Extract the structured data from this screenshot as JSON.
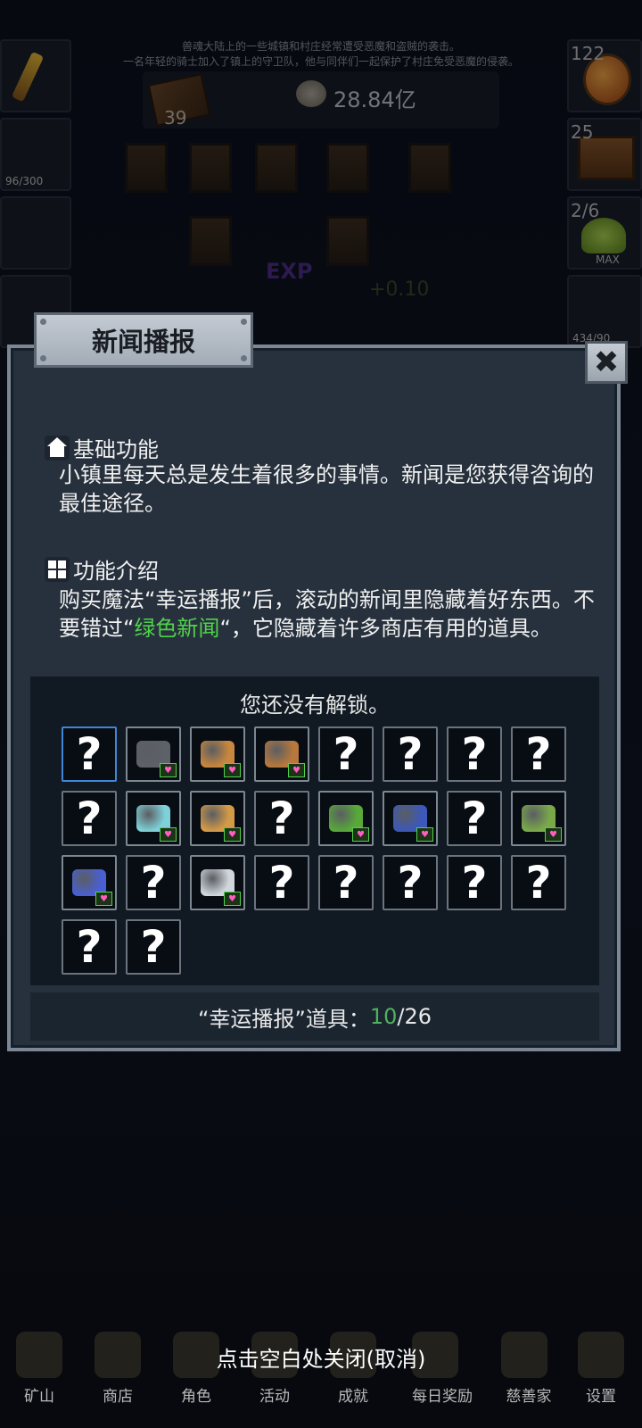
{
  "background": {
    "ticker_line1": "兽魂大陆上的一些城镇和村庄经常遭受恶魔和盗贼的袭击。",
    "ticker_line2": "一名年轻的骑士加入了镇上的守卫队，他与同伴们一起保护了村庄免受恶魔的侵袭。",
    "book_count": "39",
    "gold": "28.84亿",
    "left_slot_sub": "96/300",
    "right_potion": "122",
    "right_chest": "25",
    "right_slime": "2/6",
    "right_slime_sub": "MAX",
    "right_sword_sub": "434/90",
    "exp_label": "EXP",
    "exp_plus": "+0.10"
  },
  "modal": {
    "title": "新闻播报",
    "close_label": "✖",
    "section1_title": "基础功能",
    "section1_text": "小镇里每天总是发生着很多的事情。新闻是您获得咨询的最佳途径。",
    "section2_title": "功能介绍",
    "section2_text_a": "购买魔法“幸运播报”后，滚动的新闻里隐藏着好东西。不要错过“",
    "section2_highlight": "绿色新闻",
    "section2_text_b": "“，它隐藏着许多商店有用的道具。",
    "unlock_message": "您还没有解锁。",
    "count_label": "“幸运播报”道具：",
    "count_have": "10",
    "count_sep": " / ",
    "count_total": "26"
  },
  "items": [
    {
      "state": "unknown",
      "selected": true
    },
    {
      "state": "unlocked",
      "icon": "ore-stone-icon",
      "color": "#5d6168"
    },
    {
      "state": "unlocked",
      "icon": "copper-nugget-icon",
      "color": "#c8863e"
    },
    {
      "state": "unlocked",
      "icon": "wood-plank-icon",
      "color": "#b7773d"
    },
    {
      "state": "unknown"
    },
    {
      "state": "unknown"
    },
    {
      "state": "unknown"
    },
    {
      "state": "unknown"
    },
    {
      "state": "unknown"
    },
    {
      "state": "unlocked",
      "icon": "crystal-cluster-icon",
      "color": "#7fd0d8"
    },
    {
      "state": "unlocked",
      "icon": "amber-ore-icon",
      "color": "#d49a48"
    },
    {
      "state": "unknown"
    },
    {
      "state": "unlocked",
      "icon": "emerald-crystal-icon",
      "color": "#58a83a"
    },
    {
      "state": "unlocked",
      "icon": "sapphire-ore-icon",
      "color": "#3c58b8"
    },
    {
      "state": "unknown"
    },
    {
      "state": "unlocked",
      "icon": "jade-ore-icon",
      "color": "#7aa94a"
    },
    {
      "state": "unlocked",
      "icon": "sapphire-gem-icon",
      "color": "#4a5fd0"
    },
    {
      "state": "unknown"
    },
    {
      "state": "unlocked",
      "icon": "diamond-icon",
      "color": "#cfd6dc"
    },
    {
      "state": "unknown"
    },
    {
      "state": "unknown"
    },
    {
      "state": "unknown"
    },
    {
      "state": "unknown"
    },
    {
      "state": "unknown"
    },
    {
      "state": "unknown"
    },
    {
      "state": "unknown"
    }
  ],
  "unknown_glyph": "?",
  "heart_glyph": "♥",
  "nav": [
    "矿山",
    "商店",
    "角色",
    "活动",
    "成就",
    "每日奖励",
    "慈善家",
    "设置"
  ],
  "close_hint": "点击空白处关闭(取消)"
}
